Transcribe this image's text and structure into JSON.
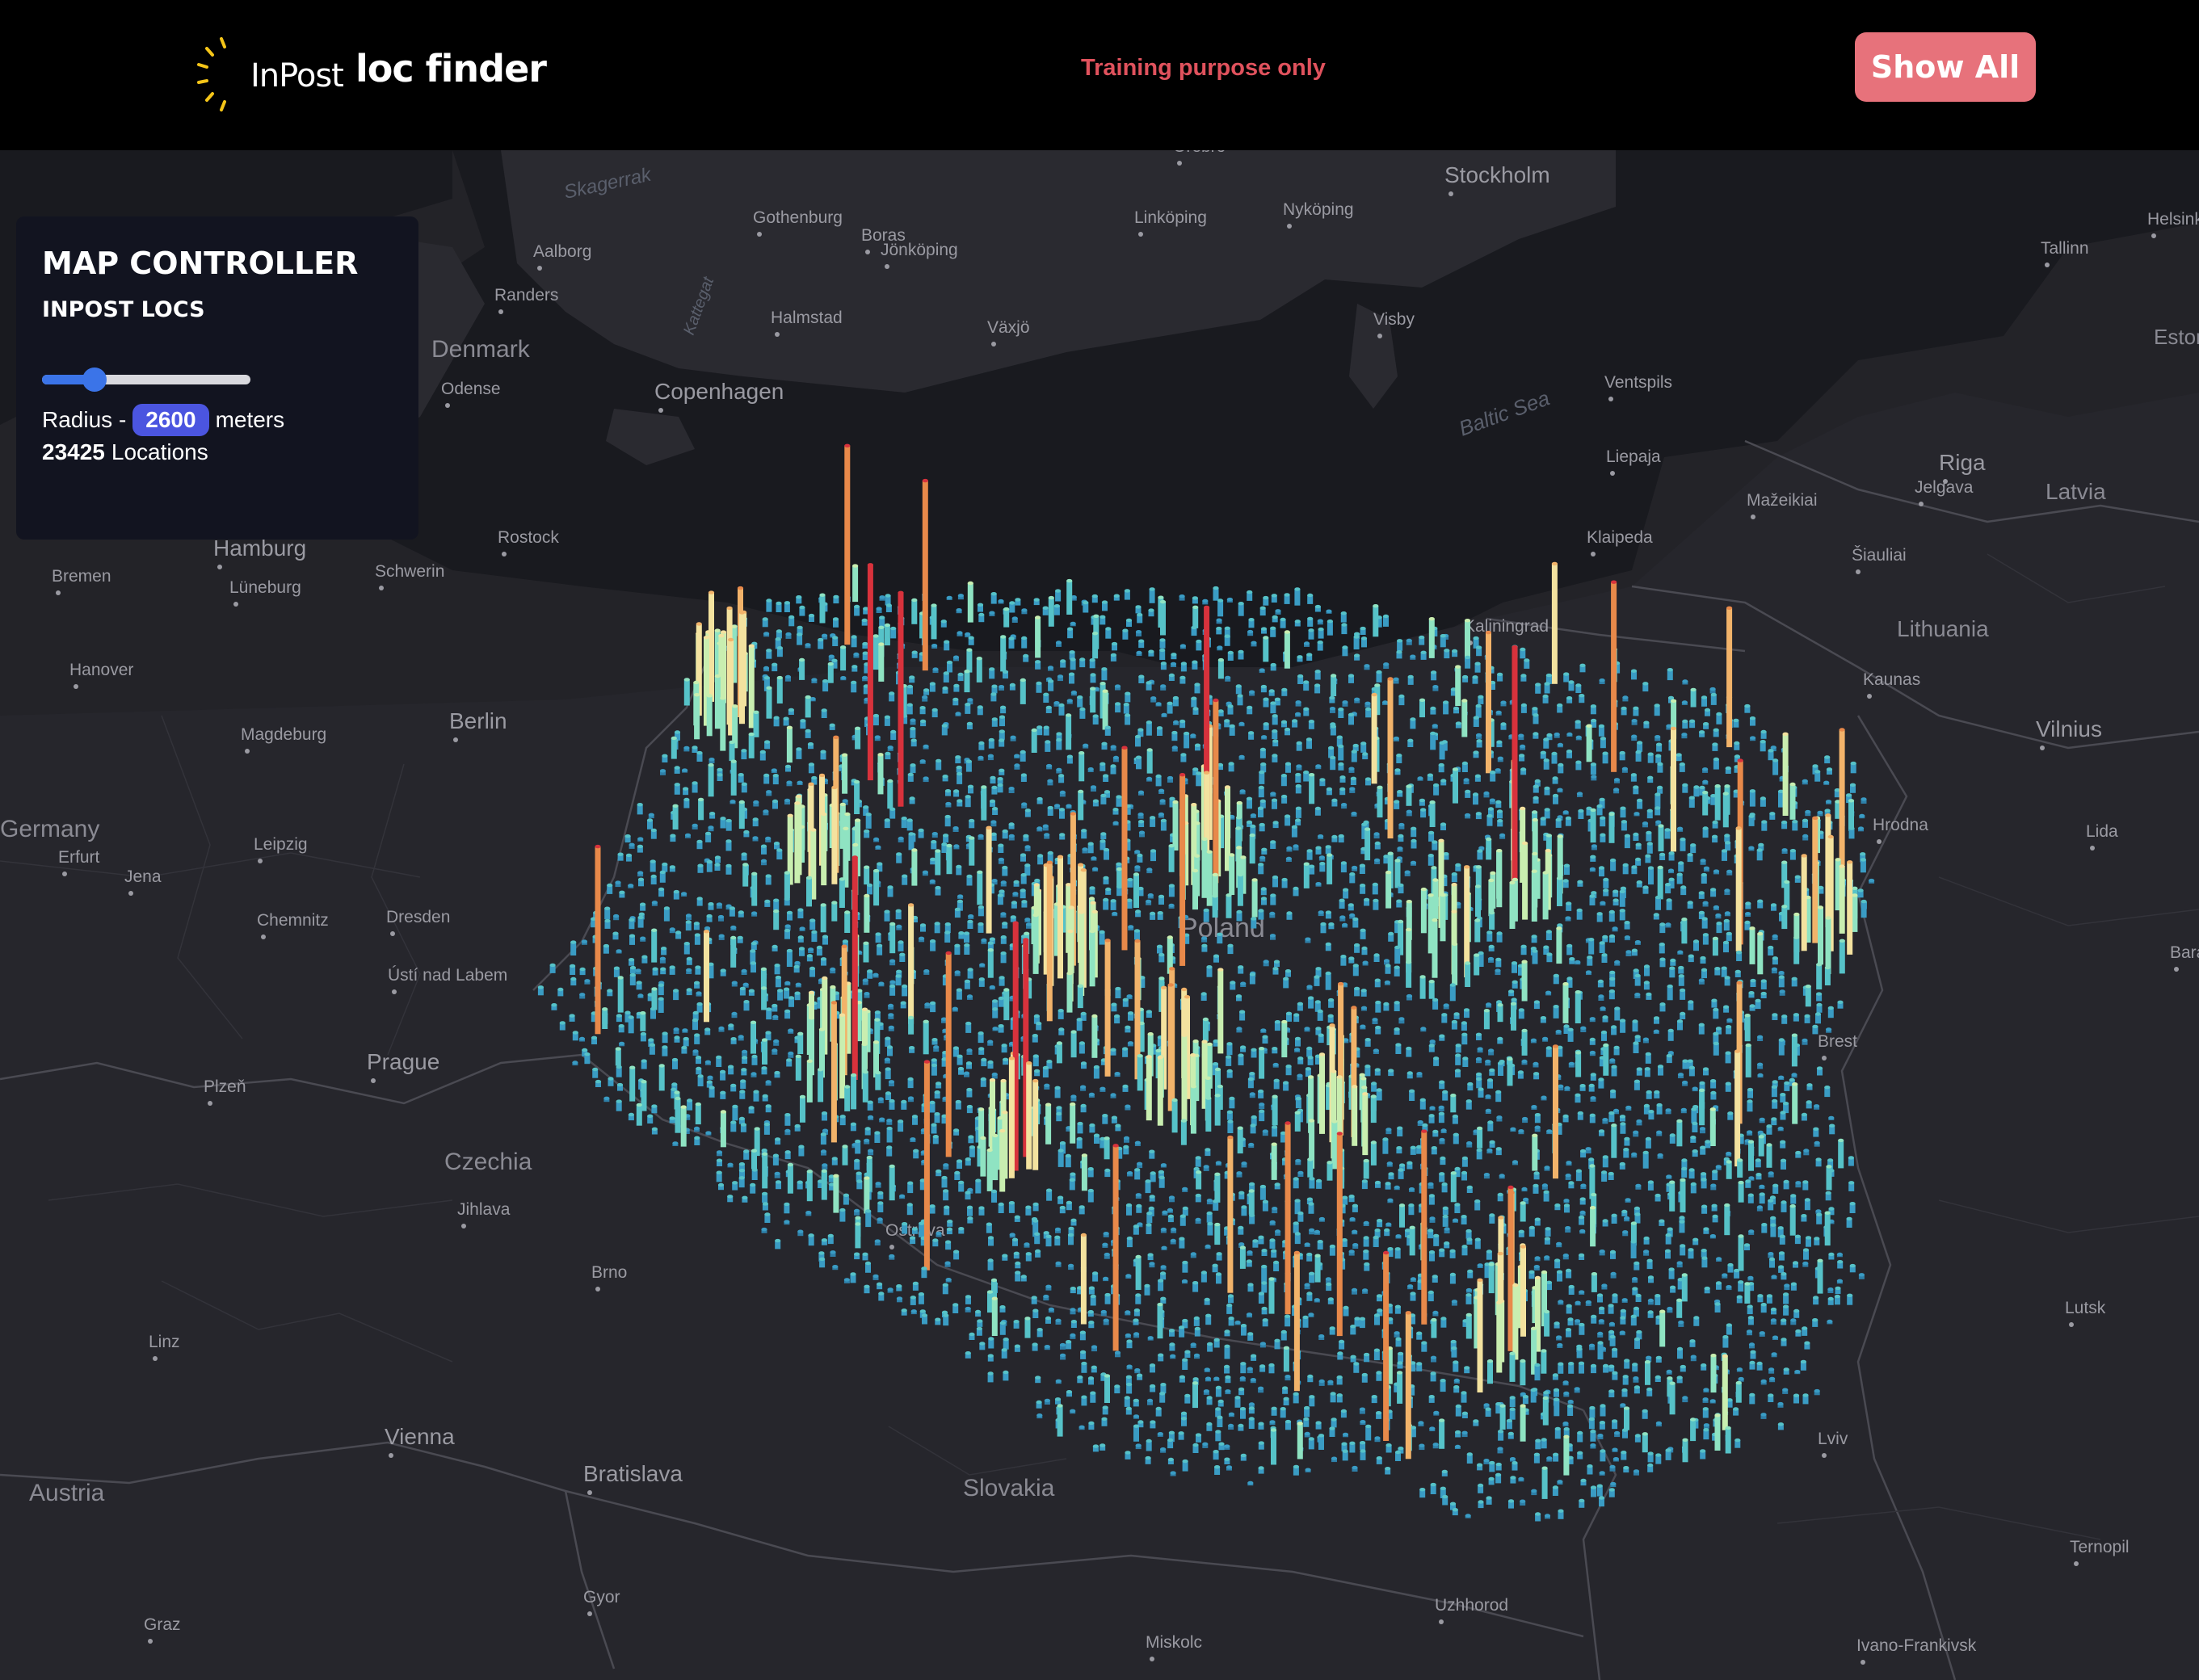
{
  "header": {
    "logo_text": "InPost",
    "app_title": "loc finder",
    "notice": "Training purpose only",
    "show_all_label": "Show All"
  },
  "panel": {
    "title": "MAP CONTROLLER",
    "subtitle": "INPOST LOCS",
    "slider_value_fraction": 0.25,
    "radius_prefix": "Radius -",
    "radius_value": "2600",
    "radius_unit": "meters",
    "location_count": "23425",
    "location_label": "Locations"
  },
  "map": {
    "countries": [
      "Denmark",
      "Latvia",
      "Lithuania",
      "Czechia",
      "Austria",
      "Slovakia",
      "Poland",
      "Estonia",
      "Germany"
    ],
    "seas": [
      "Skagerrak",
      "Kattegat",
      "Baltic Sea"
    ],
    "cities": [
      "Stockholm",
      "Helsinki",
      "Tallinn",
      "Orebro",
      "Gothenburg",
      "Boras",
      "Linköping",
      "Nyköping",
      "Jönköping",
      "Aalborg",
      "Randers",
      "Halmstad",
      "Växjö",
      "Visby",
      "Odense",
      "Copenhagen",
      "Ventspils",
      "Liepaja",
      "Riga",
      "Jelgava",
      "Mažeikiai",
      "Šiauliai",
      "Hamburg",
      "Bremen",
      "Lüneburg",
      "Schwerin",
      "Rostock",
      "Klaipeda",
      "Kaliningrad",
      "Kaunas",
      "Vilnius",
      "Hanover",
      "Magdeburg",
      "Berlin",
      "Hrodna",
      "Lida",
      "Erfurt",
      "Jena",
      "Leipzig",
      "Chemnitz",
      "Dresden",
      "Ústí nad Labem",
      "Baran",
      "Brest",
      "Plzeň",
      "Prague",
      "Jihlava",
      "Brno",
      "Linz",
      "Ostrava",
      "Vienna",
      "Bratislava",
      "Lutsk",
      "Lviv",
      "Ternopil",
      "Uzhhorod",
      "Gyor",
      "Graz",
      "Miskolc",
      "Ivano-Frankivsk"
    ],
    "hexbin_colors": [
      "#2e7fa8",
      "#3a9cc4",
      "#56c2c8",
      "#8fe3c2",
      "#c9eeb0",
      "#f3e29f",
      "#f2b36a",
      "#e8894a",
      "#d8323c"
    ]
  }
}
